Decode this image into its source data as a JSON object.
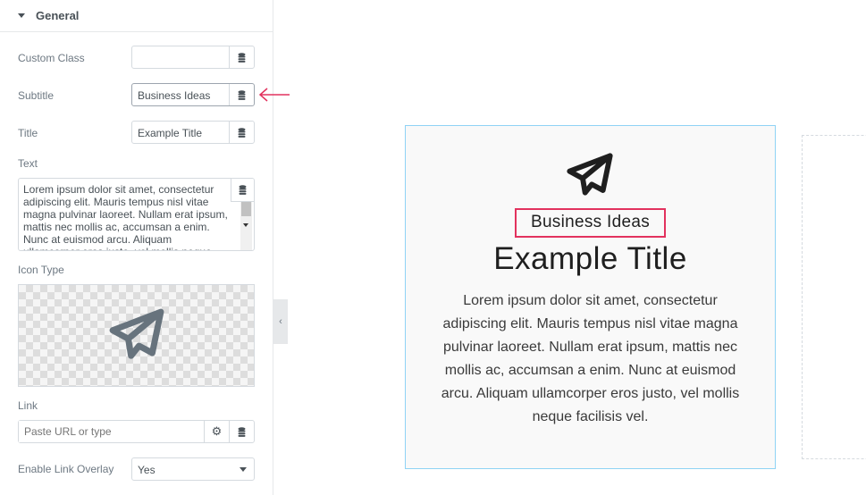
{
  "panel": {
    "section": "General",
    "custom_class": {
      "label": "Custom Class",
      "value": ""
    },
    "subtitle": {
      "label": "Subtitle",
      "value": "Business Ideas"
    },
    "title": {
      "label": "Title",
      "value": "Example Title"
    },
    "text": {
      "label": "Text",
      "value": "Lorem ipsum dolor sit amet, consectetur adipiscing elit. Mauris tempus nisl vitae magna pulvinar laoreet. Nullam erat ipsum, mattis nec mollis ac, accumsan a enim. Nunc at euismod arcu. Aliquam ullamcorper eros justo, vel mollis neque facilisis vel."
    },
    "icon_type": {
      "label": "Icon Type",
      "icon": "paper-plane-icon"
    },
    "link": {
      "label": "Link",
      "placeholder": "Paste URL or type"
    },
    "link_overlay": {
      "label": "Enable Link Overlay",
      "value": "Yes"
    }
  },
  "preview": {
    "icon": "paper-plane-icon",
    "subtitle": "Business Ideas",
    "title": "Example Title",
    "text": "Lorem ipsum dolor sit amet, consectetur adipiscing elit. Mauris tempus nisl vitae magna pulvinar laoreet. Nullam erat ipsum, mattis nec mollis ac, accumsan a enim. Nunc at euismod arcu. Aliquam ullamcorper eros justo, vel mollis neque facilisis vel."
  },
  "colors": {
    "highlight": "#e2325e",
    "card_border": "#8fd3f5"
  }
}
